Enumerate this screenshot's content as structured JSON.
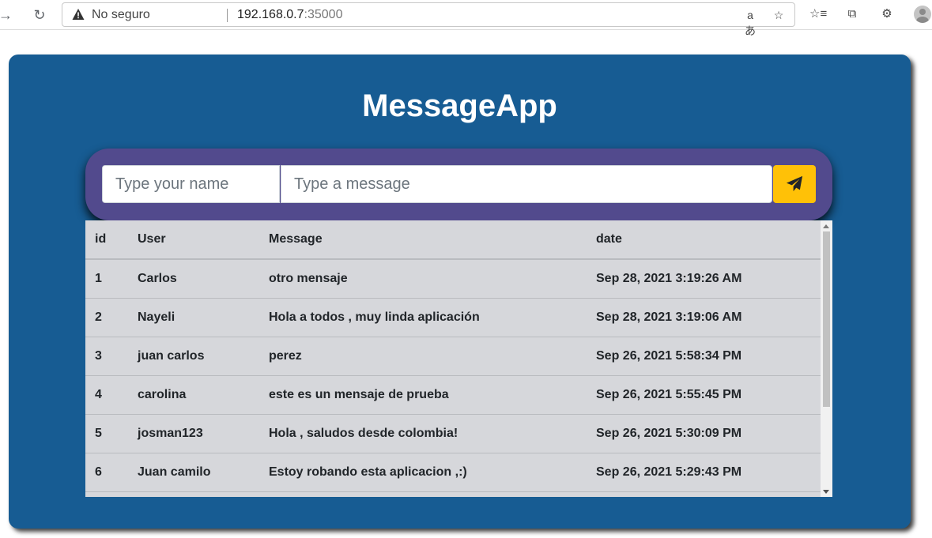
{
  "browser": {
    "insecure_label": "No seguro",
    "host": "192.168.0.7",
    "port": ":35000"
  },
  "app": {
    "title": "MessageApp",
    "name_placeholder": "Type your name",
    "message_placeholder": "Type a message",
    "send_icon": "paper-plane-icon",
    "accent": "#ffc107",
    "card_color": "#175c93",
    "form_color": "#524a8d"
  },
  "table": {
    "headers": [
      "id",
      "User",
      "Message",
      "date"
    ],
    "rows": [
      {
        "id": "1",
        "user": "Carlos",
        "message": "otro mensaje",
        "date": "Sep 28, 2021 3:19:26 AM"
      },
      {
        "id": "2",
        "user": "Nayeli",
        "message": "Hola a todos , muy linda aplicación",
        "date": "Sep 28, 2021 3:19:06 AM"
      },
      {
        "id": "3",
        "user": "juan carlos",
        "message": "perez",
        "date": "Sep 26, 2021 5:58:34 PM"
      },
      {
        "id": "4",
        "user": "carolina",
        "message": "este es un mensaje de prueba",
        "date": "Sep 26, 2021 5:55:45 PM"
      },
      {
        "id": "5",
        "user": "josman123",
        "message": "Hola , saludos desde colombia!",
        "date": "Sep 26, 2021 5:30:09 PM"
      },
      {
        "id": "6",
        "user": "Juan camilo",
        "message": "Estoy robando esta aplicacion ,:)",
        "date": "Sep 26, 2021 5:29:43 PM"
      }
    ]
  }
}
